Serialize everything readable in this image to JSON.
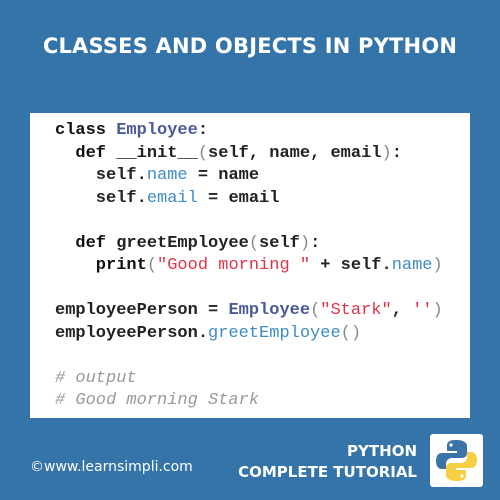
{
  "title": "CLASSES AND OBJECTS IN PYTHON",
  "code_lines": [
    [
      [
        "class ",
        "kw"
      ],
      [
        "Employee",
        "cls"
      ],
      [
        ":",
        "plain"
      ]
    ],
    [
      [
        "  def ",
        "kw"
      ],
      [
        "__init__",
        "plain"
      ],
      [
        "(",
        "punc"
      ],
      [
        "self, name, email",
        "plain"
      ],
      [
        ")",
        "punc"
      ],
      [
        ":",
        "plain"
      ]
    ],
    [
      [
        "    self.",
        "plain"
      ],
      [
        "name",
        "attr"
      ],
      [
        " = name",
        "plain"
      ]
    ],
    [
      [
        "    self.",
        "plain"
      ],
      [
        "email",
        "attr"
      ],
      [
        " = email",
        "plain"
      ]
    ],
    [],
    [
      [
        "  def ",
        "kw"
      ],
      [
        "greetEmployee",
        "plain"
      ],
      [
        "(",
        "punc"
      ],
      [
        "self",
        "plain"
      ],
      [
        ")",
        "punc"
      ],
      [
        ":",
        "plain"
      ]
    ],
    [
      [
        "    print",
        "kw"
      ],
      [
        "(",
        "punc"
      ],
      [
        "\"Good morning \"",
        "str"
      ],
      [
        " + self.",
        "plain"
      ],
      [
        "name",
        "attr"
      ],
      [
        ")",
        "punc"
      ]
    ],
    [],
    [
      [
        "employeePerson = ",
        "plain"
      ],
      [
        "Employee",
        "cls"
      ],
      [
        "(",
        "punc"
      ],
      [
        "\"Stark\"",
        "str"
      ],
      [
        ", ",
        "plain"
      ],
      [
        "''",
        "str"
      ],
      [
        ")",
        "punc"
      ]
    ],
    [
      [
        "employeePerson.",
        "plain"
      ],
      [
        "greetEmployee",
        "attr"
      ],
      [
        "()",
        "punc"
      ]
    ],
    [],
    [
      [
        "# output",
        "cm"
      ]
    ],
    [
      [
        "# Good morning Stark",
        "cm"
      ]
    ]
  ],
  "footer": {
    "copyright": "©www.learnsimpli.com",
    "line1": "PYTHON",
    "line2": "COMPLETE TUTORIAL"
  },
  "logo_icon": "python-logo-icon",
  "colors": {
    "background": "#3574a8",
    "keyword": "#111111",
    "class": "#4a5a96",
    "attribute": "#3f8bc4",
    "string": "#e0324a",
    "comment": "#999999"
  }
}
